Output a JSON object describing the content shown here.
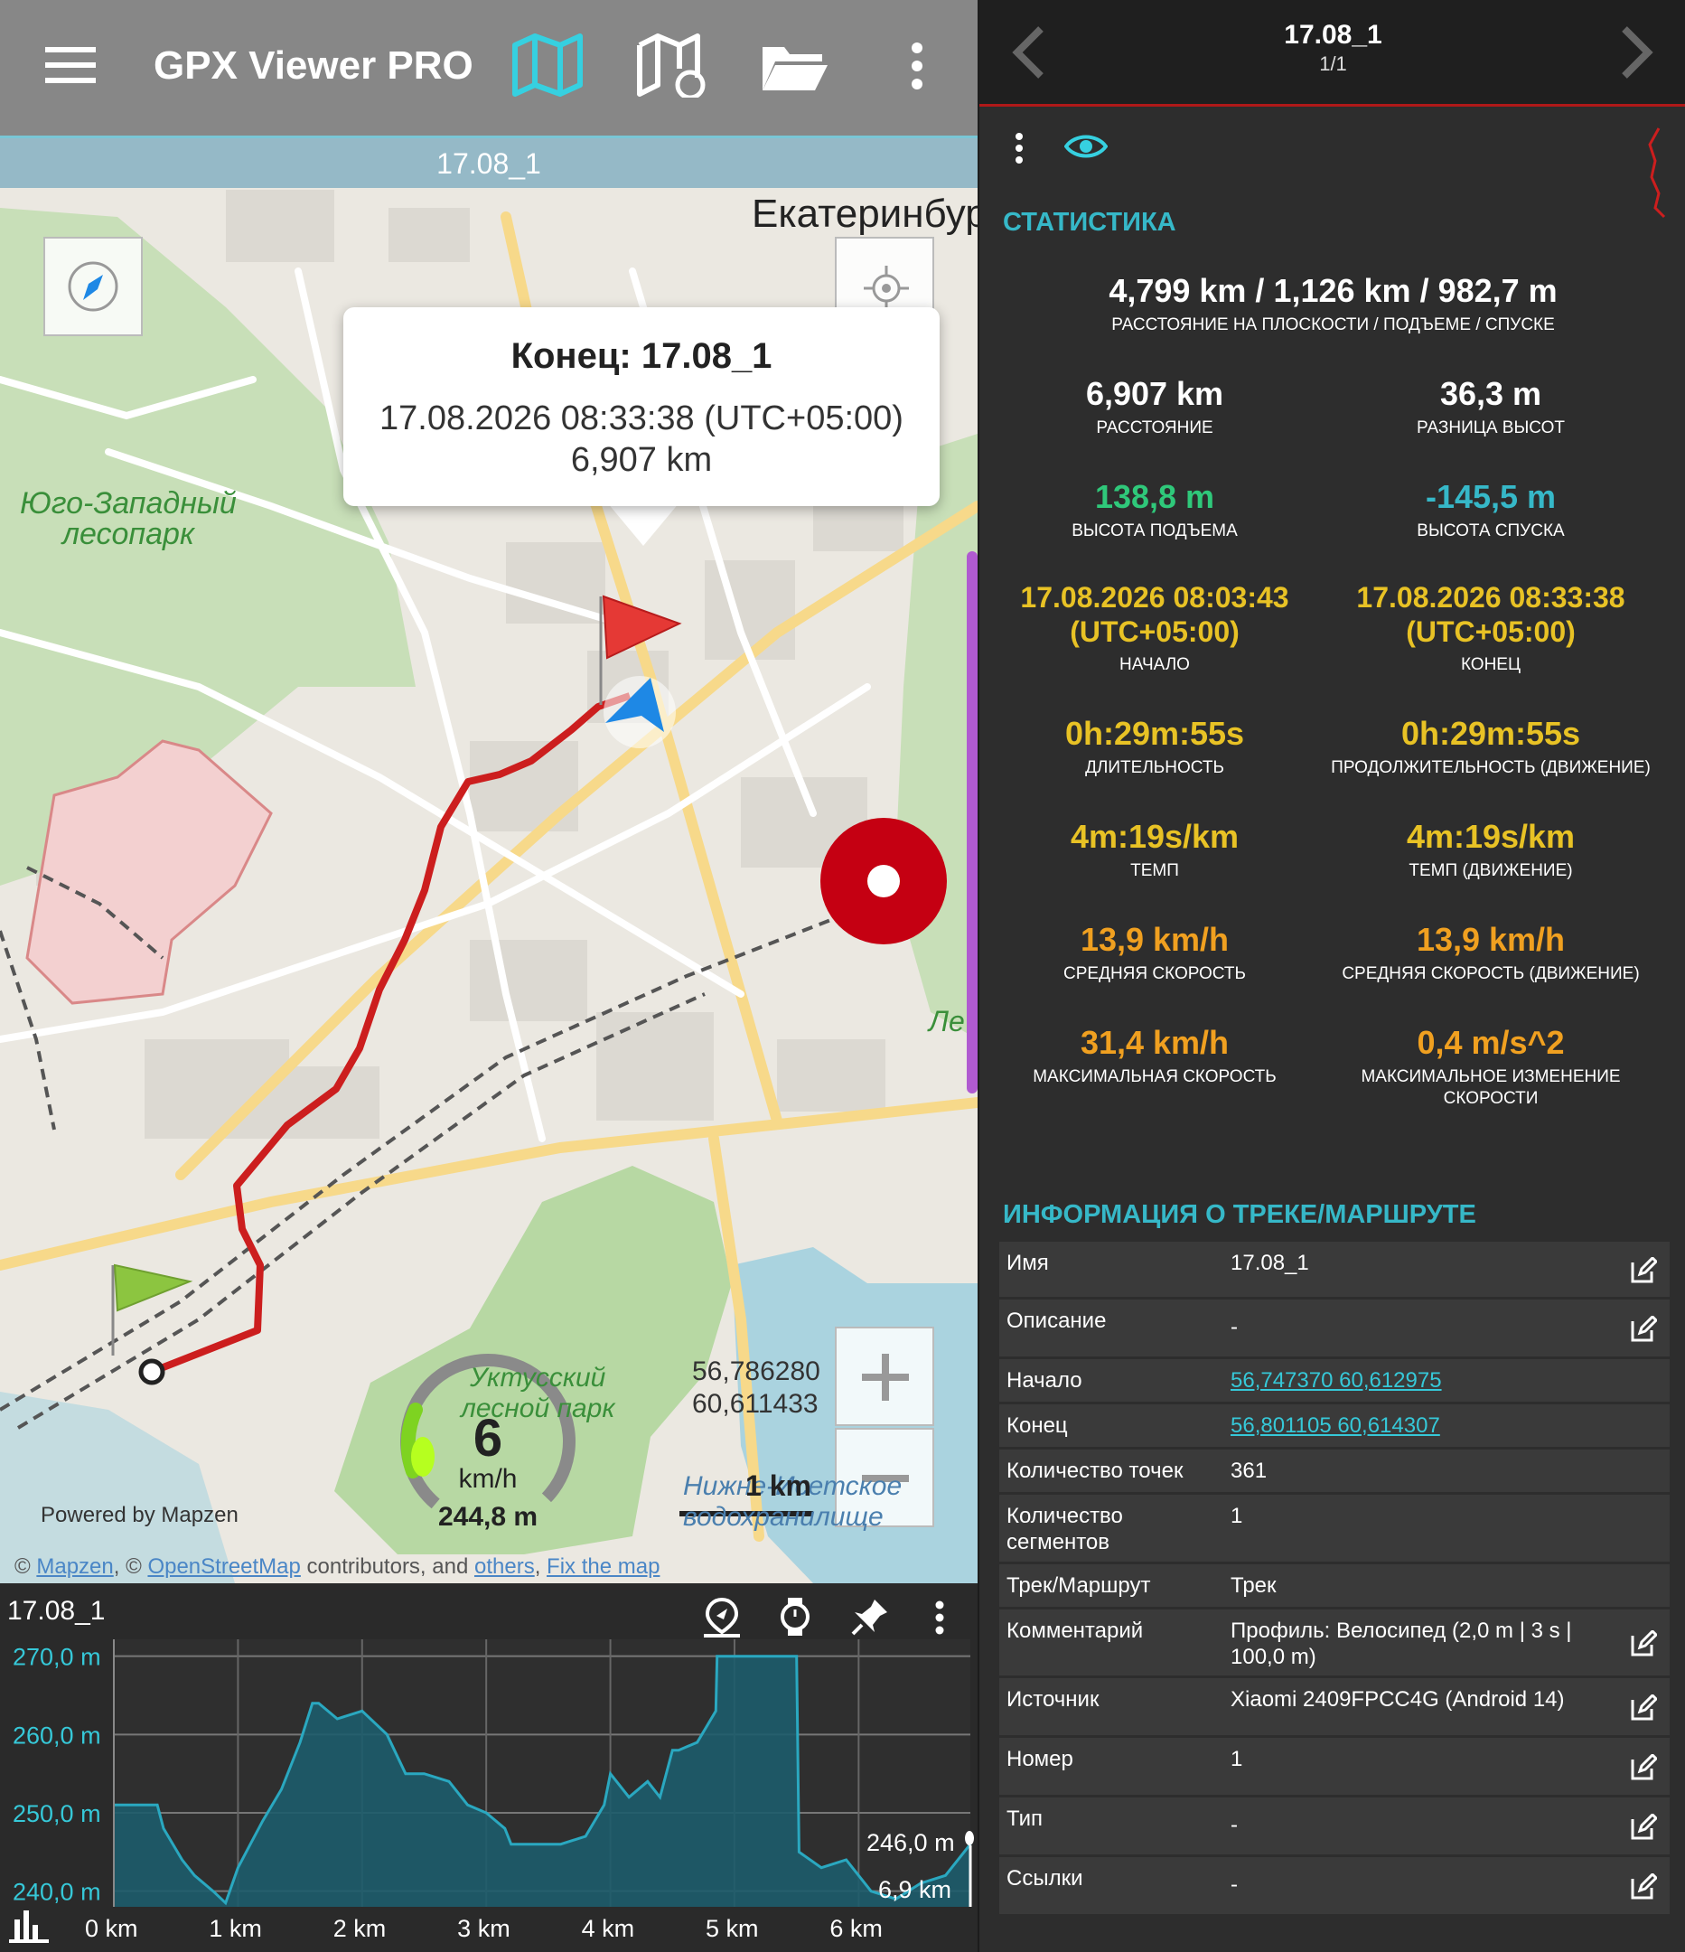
{
  "app": {
    "title": "GPX Viewer PRO"
  },
  "map": {
    "track_name": "17.08_1",
    "city_label": "Екатеринбург",
    "forest_label_1": "Юго-Западный",
    "forest_label_2": "лесопарк",
    "park_label_1": "Уктусский",
    "park_label_2": "лесной парк",
    "reservoir_label_1": "Нижне-Исетское",
    "reservoir_label_2": "водохранилище",
    "side_label": "Ле",
    "popup": {
      "title": "Конец: 17.08_1",
      "time": "17.08.2026 08:33:38 (UTC+05:00)",
      "distance": "6,907 km"
    },
    "coords_lat": "56,786280",
    "coords_lon": "60,611433",
    "scale": "1 km",
    "powered": "Powered by Mapzen",
    "attribution": {
      "prefix": "© ",
      "mapzen": "Mapzen",
      "sep1": ", © ",
      "osm": "OpenStreetMap",
      "mid": " contributors, and ",
      "others": "others",
      "sep2": ", ",
      "fix": "Fix the map"
    },
    "speed": {
      "value": "6",
      "unit": "km/h",
      "elevation": "244,8 m"
    }
  },
  "elevation_chart": {
    "title": "17.08_1",
    "current_elev": "246,0 m",
    "current_dist": "6,9 km",
    "chart_data": {
      "type": "area",
      "x_ticks": [
        "0 km",
        "1 km",
        "2 km",
        "3 km",
        "4 km",
        "5 km",
        "6 km"
      ],
      "y_ticks": [
        "240,0 m",
        "250,0 m",
        "260,0 m",
        "270,0 m"
      ],
      "xlim": [
        0,
        6.9
      ],
      "ylim": [
        238,
        271
      ],
      "x": [
        0,
        0.35,
        0.4,
        0.55,
        0.65,
        0.8,
        0.9,
        1.0,
        1.1,
        1.2,
        1.35,
        1.5,
        1.6,
        1.65,
        1.8,
        2.0,
        2.2,
        2.35,
        2.5,
        2.7,
        2.85,
        3.0,
        3.15,
        3.2,
        3.4,
        3.6,
        3.8,
        3.95,
        4.0,
        4.15,
        4.3,
        4.4,
        4.5,
        4.55,
        4.7,
        4.85,
        4.86,
        5.5,
        5.52,
        5.7,
        5.9,
        6.1,
        6.3,
        6.5,
        6.7,
        6.9
      ],
      "y": [
        251,
        251,
        248,
        244,
        242,
        240,
        238.5,
        243,
        246,
        249,
        253,
        259,
        264,
        264,
        262,
        263,
        260,
        255,
        255,
        254,
        251,
        250,
        248,
        246,
        246,
        246,
        247,
        251,
        255,
        252,
        254,
        252,
        258,
        258,
        259,
        263,
        270,
        270,
        245,
        243,
        244,
        240,
        239,
        241,
        242,
        246
      ]
    }
  },
  "stats": {
    "header_title": "17.08_1",
    "header_pages": "1/1",
    "section_title": "СТАТИСТИКА",
    "main_value": "4,799 km / 1,126 km / 982,7 m",
    "main_label": "РАССТОЯНИЕ НА ПЛОСКОСТИ / ПОДЪЕМЕ / СПУСКЕ",
    "distance_value": "6,907 km",
    "distance_label": "РАССТОЯНИЕ",
    "elevdiff_value": "36,3 m",
    "elevdiff_label": "РАЗНИЦА ВЫСОТ",
    "climb_value": "138,8 m",
    "climb_label": "ВЫСОТА ПОДЪЕМА",
    "descent_value": "-145,5 m",
    "descent_label": "ВЫСОТА СПУСКА",
    "start_value_1": "17.08.2026 08:03:43",
    "start_value_2": "(UTC+05:00)",
    "start_label": "НАЧАЛО",
    "end_value_1": "17.08.2026 08:33:38",
    "end_value_2": "(UTC+05:00)",
    "end_label": "КОНЕЦ",
    "duration_value": "0h:29m:55s",
    "duration_label": "ДЛИТЕЛЬНОСТЬ",
    "moving_duration_value": "0h:29m:55s",
    "moving_duration_label": "ПРОДОЛЖИТЕЛЬНОСТЬ (ДВИЖЕНИЕ)",
    "pace_value": "4m:19s/km",
    "pace_label": "ТЕМП",
    "moving_pace_value": "4m:19s/km",
    "moving_pace_label": "ТЕМП (ДВИЖЕНИЕ)",
    "avg_speed_value": "13,9 km/h",
    "avg_speed_label": "СРЕДНЯЯ СКОРОСТЬ",
    "moving_avg_speed_value": "13,9 km/h",
    "moving_avg_speed_label": "СРЕДНЯЯ СКОРОСТЬ (ДВИЖЕНИЕ)",
    "max_speed_value": "31,4 km/h",
    "max_speed_label": "МАКСИМАЛЬНАЯ СКОРОСТЬ",
    "max_accel_value": "0,4 m/s^2",
    "max_accel_label_1": "МАКСИМАЛЬНОЕ ИЗМЕНЕНИЕ",
    "max_accel_label_2": "СКОРОСТИ"
  },
  "info": {
    "section_title": "ИНФОРМАЦИЯ О ТРЕКЕ/МАРШРУТЕ",
    "rows": [
      {
        "key": "Имя",
        "value": "17.08_1"
      },
      {
        "key": "Описание",
        "value": "-"
      },
      {
        "key": "Начало",
        "value": "56,747370 60,612975"
      },
      {
        "key": "Конец",
        "value": "56,801105 60,614307"
      },
      {
        "key": "Количество точек",
        "value": "361"
      },
      {
        "key": "Количество сегментов",
        "value": "1"
      },
      {
        "key": "Трек/Маршрут",
        "value": "Трек"
      },
      {
        "key": "Комментарий",
        "value": "Профиль: Велосипед (2,0 m | 3 s | 100,0 m)"
      },
      {
        "key": "Источник",
        "value": "Xiaomi 2409FPCC4G (Android 14)"
      },
      {
        "key": "Номер",
        "value": "1"
      },
      {
        "key": "Тип",
        "value": "-"
      },
      {
        "key": "Ссылки",
        "value": "-"
      }
    ]
  }
}
